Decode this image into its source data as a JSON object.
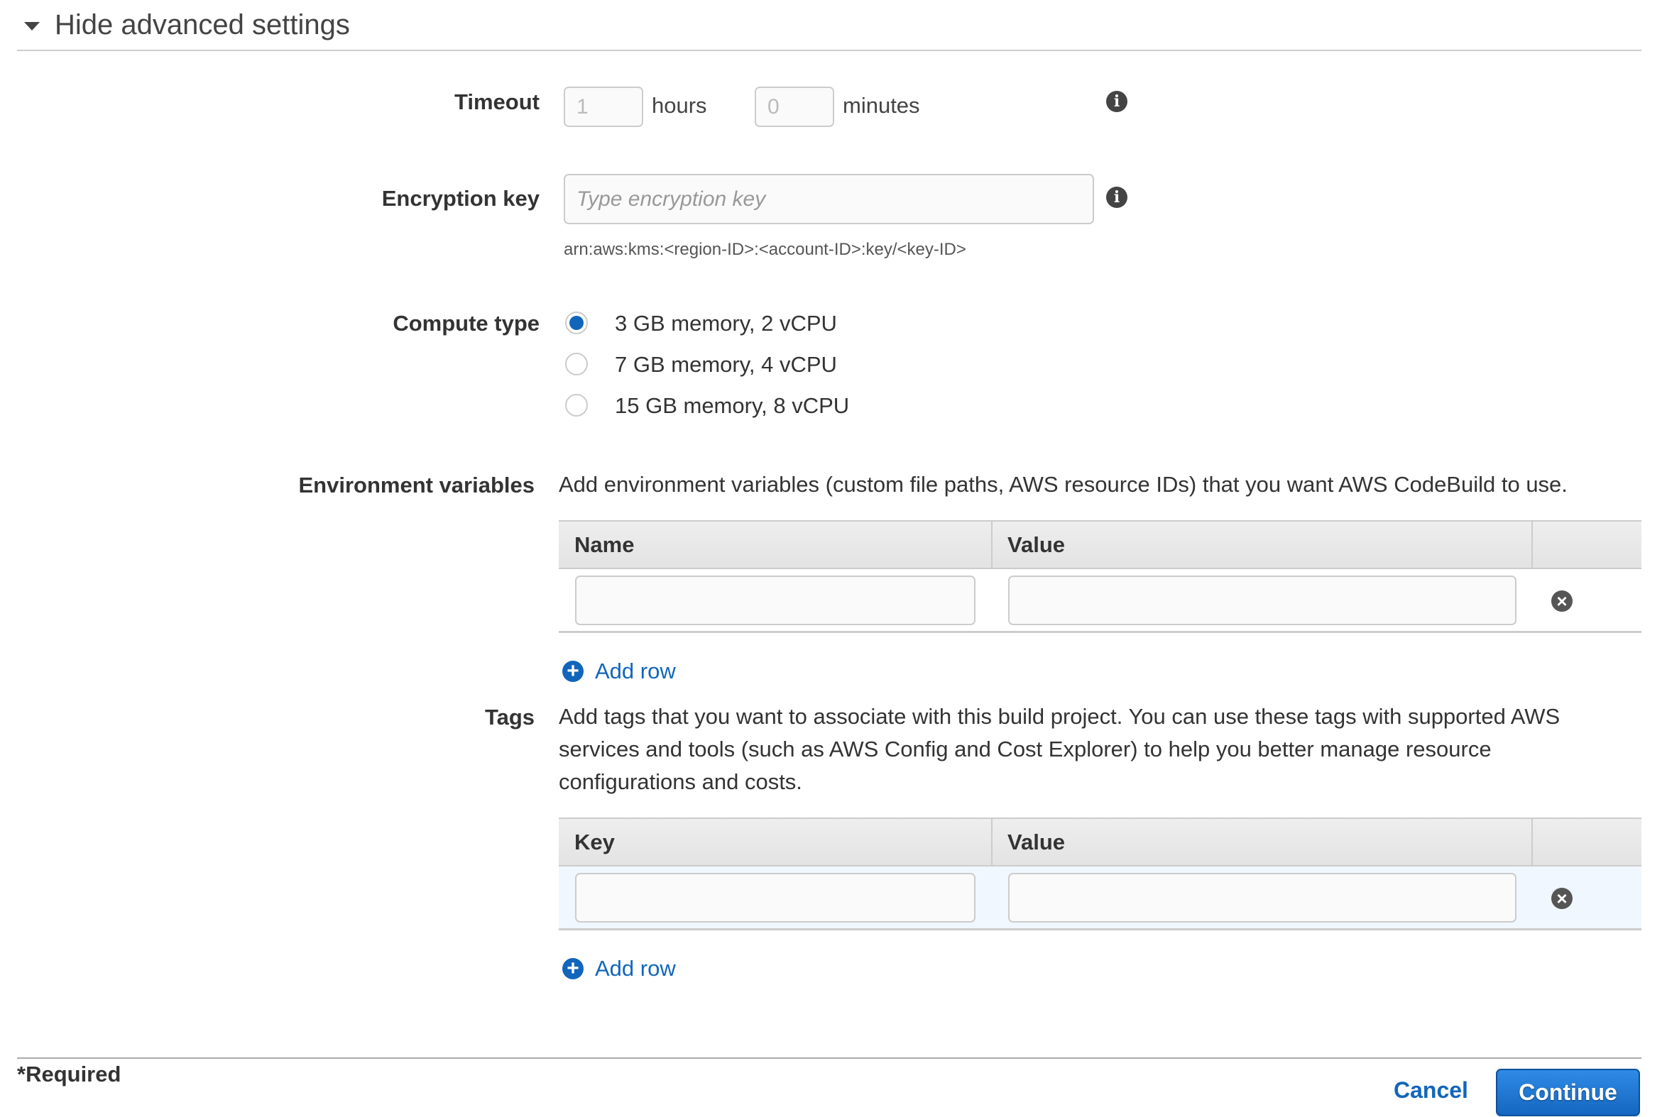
{
  "section": {
    "toggle_label": "Hide advanced settings",
    "expanded": true
  },
  "timeout": {
    "label": "Timeout",
    "hours": {
      "value": "",
      "placeholder": "1",
      "unit": "hours"
    },
    "minutes": {
      "value": "",
      "placeholder": "0",
      "unit": "minutes"
    },
    "info_icon": "info-icon"
  },
  "encryption": {
    "label": "Encryption key",
    "value": "",
    "placeholder": "Type encryption key",
    "helper": "arn:aws:kms:<region-ID>:<account-ID>:key/<key-ID>",
    "info_icon": "info-icon"
  },
  "compute": {
    "label": "Compute type",
    "options": [
      {
        "label": "3 GB memory, 2 vCPU",
        "selected": true
      },
      {
        "label": "7 GB memory, 4 vCPU",
        "selected": false
      },
      {
        "label": "15 GB memory, 8 vCPU",
        "selected": false
      }
    ]
  },
  "env_vars": {
    "label": "Environment variables",
    "description": "Add environment variables (custom file paths, AWS resource IDs) that you want AWS CodeBuild to use.",
    "columns": [
      "Name",
      "Value",
      ""
    ],
    "rows": [
      {
        "name": "",
        "value": ""
      }
    ],
    "add_row_label": "Add row"
  },
  "tags": {
    "label": "Tags",
    "description_lines": [
      "Add tags that you want to associate with this build project. You can use these tags with supported AWS",
      "services and tools (such as AWS Config and Cost Explorer) to help you better manage resource",
      "configurations and costs."
    ],
    "columns": [
      "Key",
      "Value",
      ""
    ],
    "rows": [
      {
        "key": "",
        "value": ""
      }
    ],
    "add_row_label": "Add row"
  },
  "footer": {
    "required_note": "*Required",
    "cancel_label": "Cancel",
    "continue_label": "Continue"
  },
  "colors": {
    "accent": "#1166bb",
    "highlight_row": "#f0f7ff",
    "text": "#444444"
  }
}
